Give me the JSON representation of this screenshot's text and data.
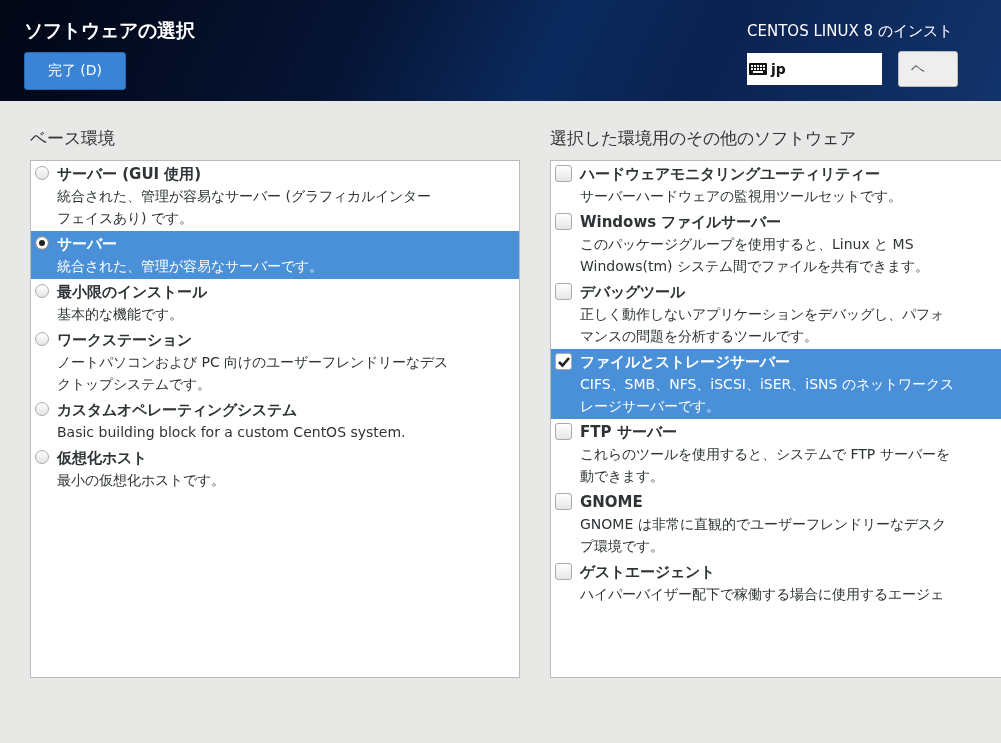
{
  "header": {
    "title": "ソフトウェアの選択",
    "done_button": "完了 (D)",
    "product": "CENTOS LINUX 8 のインスト",
    "keyboard": "jp",
    "help_button": "ヘ"
  },
  "base_environment": {
    "heading": "ベース環境",
    "items": [
      {
        "name": "サーバー (GUI 使用)",
        "description": [
          "統合された、管理が容易なサーバー (グラフィカルインター",
          "フェイスあり) です。"
        ],
        "selected": false
      },
      {
        "name": "サーバー",
        "description": [
          "統合された、管理が容易なサーバーです。"
        ],
        "selected": true
      },
      {
        "name": "最小限のインストール",
        "description": [
          "基本的な機能です。"
        ],
        "selected": false
      },
      {
        "name": "ワークステーション",
        "description": [
          "ノートパソコンおよび PC 向けのユーザーフレンドリーなデス",
          "クトップシステムです。"
        ],
        "selected": false
      },
      {
        "name": "カスタムオペレーティングシステム",
        "description": [
          "Basic building block for a custom CentOS system."
        ],
        "selected": false
      },
      {
        "name": "仮想化ホスト",
        "description": [
          "最小の仮想化ホストです。"
        ],
        "selected": false
      }
    ]
  },
  "additional_software": {
    "heading": "選択した環境用のその他のソフトウェア",
    "items": [
      {
        "name": "ハードウェアモニタリングユーティリティー",
        "description": [
          "サーバーハードウェアの監視用ツールセットです。"
        ],
        "checked": false,
        "selected": false
      },
      {
        "name": "Windows ファイルサーバー",
        "description": [
          "このパッケージグループを使用すると、Linux と MS",
          "Windows(tm) システム間でファイルを共有できます。"
        ],
        "checked": false,
        "selected": false
      },
      {
        "name": "デバッグツール",
        "description": [
          "正しく動作しないアプリケーションをデバッグし、パフォ",
          "マンスの問題を分析するツールです。"
        ],
        "checked": false,
        "selected": false
      },
      {
        "name": "ファイルとストレージサーバー",
        "description": [
          "CIFS、SMB、NFS、iSCSI、iSER、iSNS のネットワークス",
          "レージサーバーです。"
        ],
        "checked": true,
        "selected": true
      },
      {
        "name": "FTP サーバー",
        "description": [
          "これらのツールを使用すると、システムで FTP サーバーを",
          "動できます。"
        ],
        "checked": false,
        "selected": false
      },
      {
        "name": "GNOME",
        "description": [
          "GNOME は非常に直観的でユーザーフレンドリーなデスク",
          "プ環境です。"
        ],
        "checked": false,
        "selected": false
      },
      {
        "name": "ゲストエージェント",
        "description": [
          "ハイパーバイザー配下で稼働する場合に使用するエージェ"
        ],
        "checked": false,
        "selected": false
      }
    ]
  }
}
